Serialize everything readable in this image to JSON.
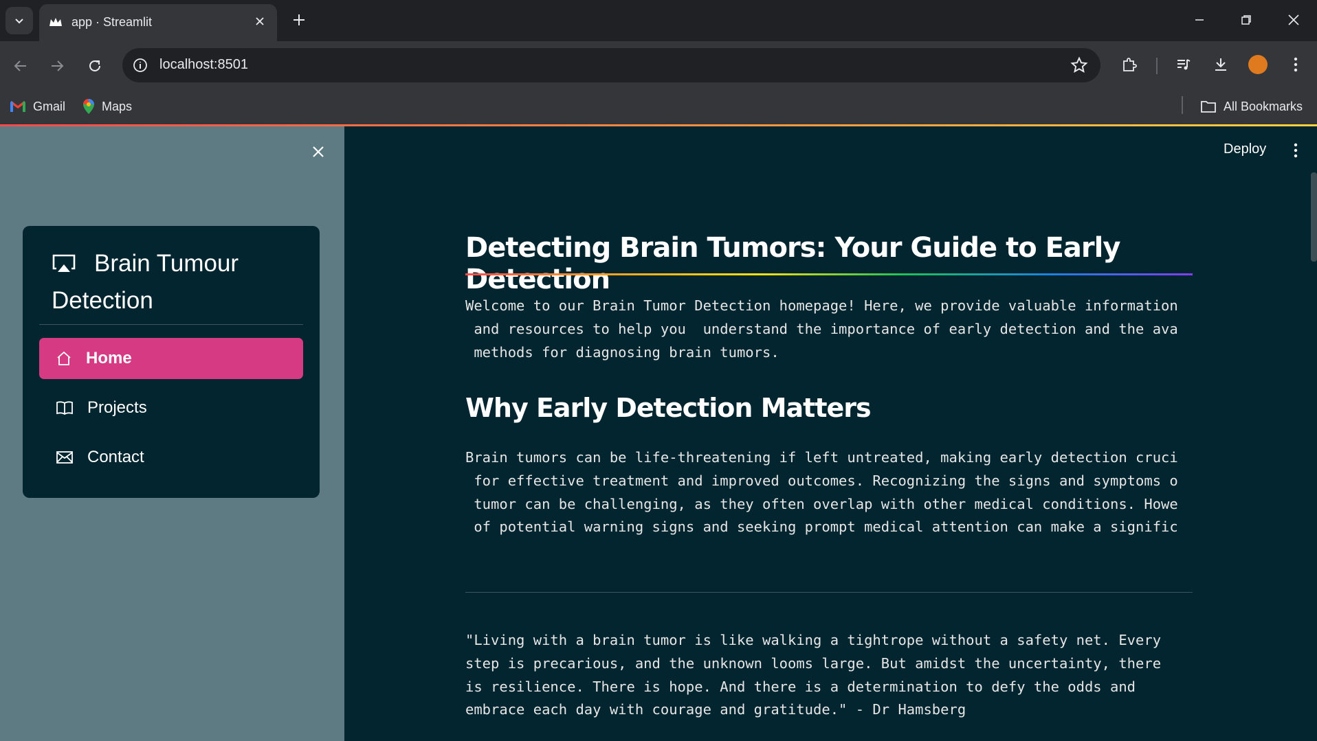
{
  "browser": {
    "tab_title": "app · Streamlit",
    "url": "localhost:8501",
    "bookmarks": [
      "Gmail",
      "Maps"
    ],
    "all_bookmarks": "All Bookmarks"
  },
  "app": {
    "deploy_label": "Deploy",
    "sidebar": {
      "title": "Brain Tumour Detection",
      "items": [
        {
          "label": "Home",
          "icon": "house-icon",
          "active": true
        },
        {
          "label": "Projects",
          "icon": "book-icon",
          "active": false
        },
        {
          "label": "Contact",
          "icon": "envelope-icon",
          "active": false
        }
      ],
      "accent_color": "#d63a83"
    },
    "main": {
      "title": "Detecting Brain Tumors: Your Guide to Early Detection",
      "intro_lines": [
        "Welcome to our Brain Tumor Detection homepage! Here, we provide valuable information",
        " and resources to help you  understand the importance of early detection and the ava",
        " methods for diagnosing brain tumors."
      ],
      "subtitle": "Why Early Detection Matters",
      "why_lines": [
        "Brain tumors can be life-threatening if left untreated, making early detection cruci",
        " for effective treatment and improved outcomes. Recognizing the signs and symptoms o",
        " tumor can be challenging, as they often overlap with other medical conditions. Howe",
        " of potential warning signs and seeking prompt medical attention can make a signific"
      ],
      "quote_lines": [
        "\"Living with a brain tumor is like walking a tightrope without a safety net. Every",
        "step is precarious, and the unknown looms large. But amidst the uncertainty, there",
        "is resilience. There is hope. And there is a determination to defy the odds and",
        "embrace each day with courage and gratitude.\" - Dr Hamsberg"
      ]
    }
  }
}
